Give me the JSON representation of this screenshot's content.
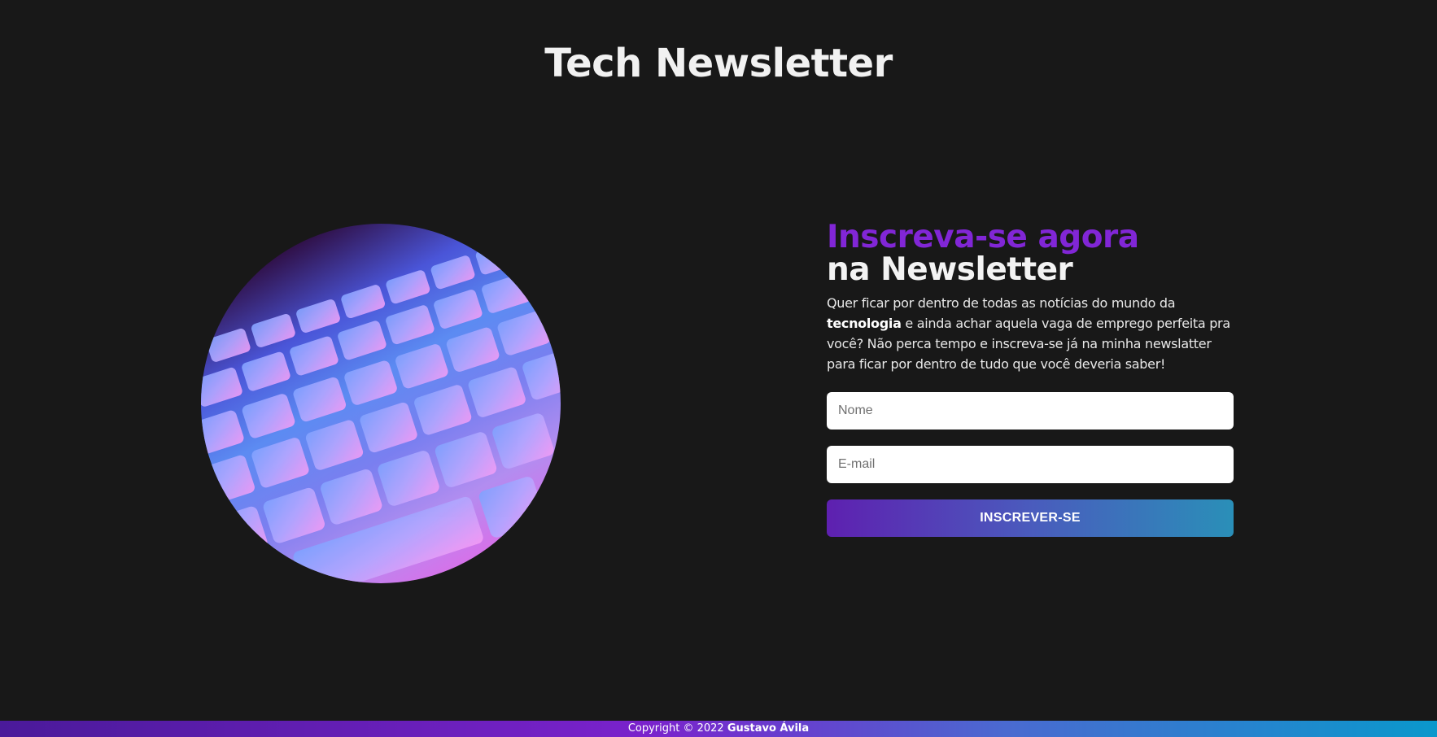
{
  "header": {
    "title": "Tech Newsletter"
  },
  "hero": {
    "image_label": "keyboard-photo"
  },
  "signup": {
    "heading_accent": "Inscreva-se agora",
    "heading_main": "na Newsletter",
    "description_before": "Quer ficar por dentro de todas as notícias do mundo da ",
    "description_bold": "tecnologia",
    "description_after": " e ainda achar aquela vaga de emprego perfeita pra você? Não perca tempo e inscreva-se já na minha newslatter para ficar por dentro de tudo que você deveria saber!",
    "name_placeholder": "Nome",
    "email_placeholder": "E-mail",
    "submit_label": "INSCREVER-SE"
  },
  "footer": {
    "copyright_prefix": "Copyright © 2022",
    "author": "Gustavo Ávila"
  },
  "colors": {
    "background": "#181818",
    "accent": "#8126d6",
    "button_gradient_start": "#5e20b0",
    "button_gradient_end": "#2a8fb8"
  }
}
